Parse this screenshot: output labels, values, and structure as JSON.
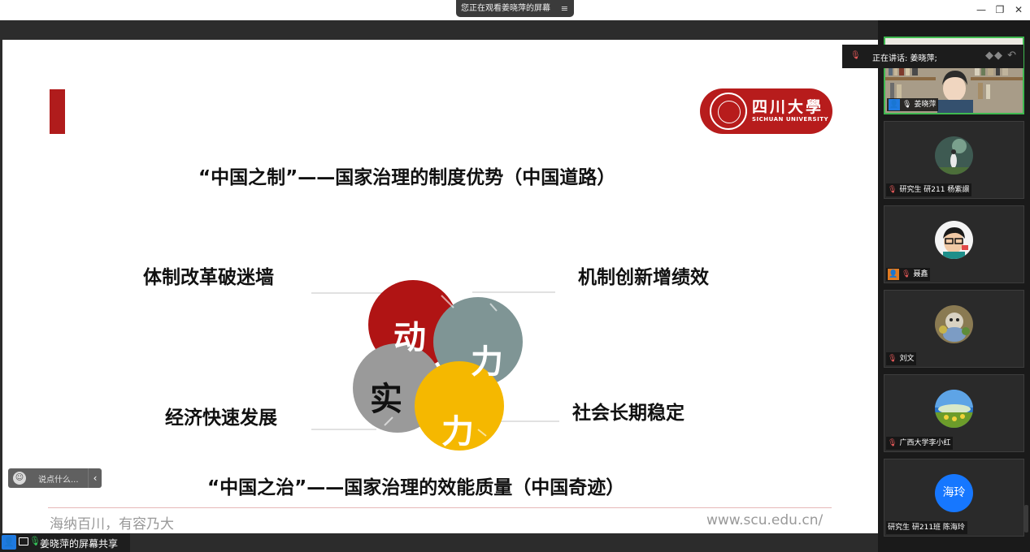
{
  "window": {
    "watch_notice": "您正在观看姜晓萍的屏幕",
    "menu_icon": "≡",
    "minimize": "—",
    "restore": "❐",
    "close": "✕"
  },
  "slide": {
    "logo_cn": "四川大學",
    "logo_en": "SICHUAN UNIVERSITY",
    "title_top": "“中国之制”——国家治理的制度优势（中国道路）",
    "title_bottom": "“中国之治”——国家治理的效能质量（中国奇迹）",
    "label_top_left": "体制改革破迷墙",
    "label_top_right": "机制创新增绩效",
    "label_bottom_left": "经济快速发展",
    "label_bottom_right": "社会长期稳定",
    "circles": [
      {
        "text": "动",
        "color": "#b01414"
      },
      {
        "text": "力",
        "color": "#7f9595"
      },
      {
        "text": "实",
        "color": "#9a9a9a"
      },
      {
        "text": "力",
        "color": "#f5b800"
      }
    ],
    "motto": "海纳百川，有容乃大",
    "url": "www.scu.edu.cn/"
  },
  "comment": {
    "placeholder": "说点什么...",
    "chevron": "‹"
  },
  "share_bar": {
    "label": "姜晓萍的屏幕共享"
  },
  "speaking": {
    "text": "正在讲话: 姜晓萍;"
  },
  "participants": [
    {
      "name": "姜晓萍"
    },
    {
      "name": "研究生 研211 杨紫譞"
    },
    {
      "name": "聂鑫"
    },
    {
      "name": "刘文"
    },
    {
      "name": "广西大学李小红"
    },
    {
      "name": "研究生 研211班 陈海玲",
      "avatar_text": "海玲"
    }
  ]
}
